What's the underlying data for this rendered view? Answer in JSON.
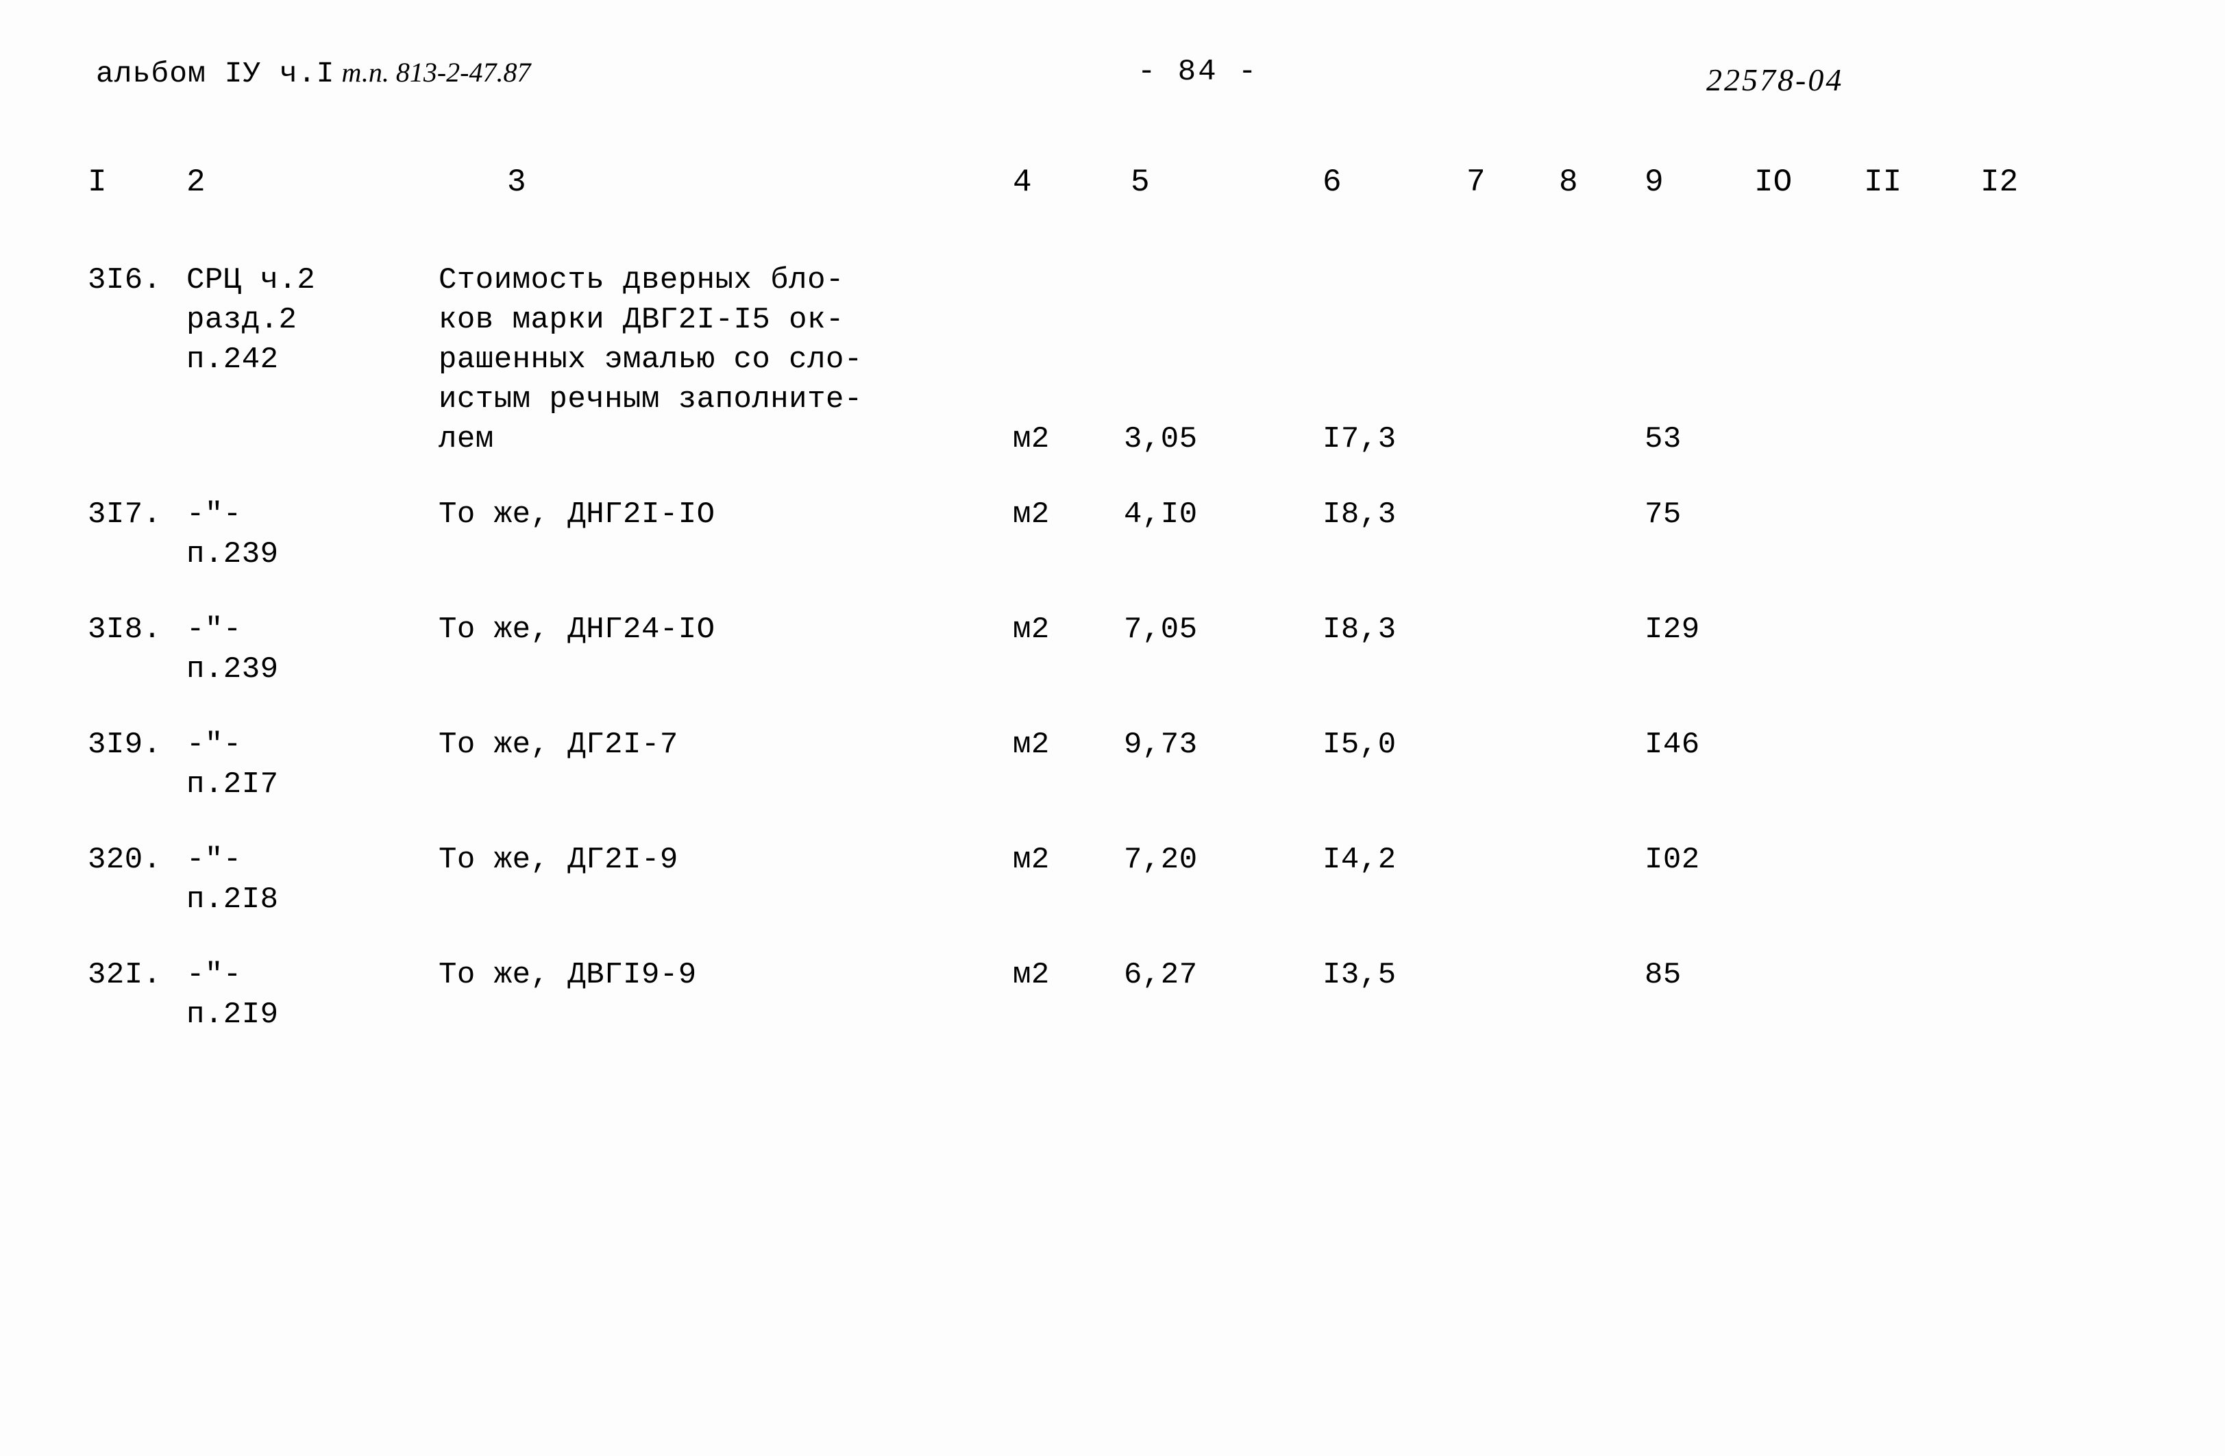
{
  "header": {
    "album_typed": "альбом IУ ч.I",
    "album_hand": "т.п. 813-2-47.87",
    "page_number": "- 84 -",
    "stamp": "22578-04"
  },
  "table": {
    "column_numbers": [
      "I",
      "2",
      "3",
      "4",
      "5",
      "6",
      "7",
      "8",
      "9",
      "IO",
      "II",
      "I2"
    ],
    "rule_dashes": "- - - - - - - - - - - - - - - - - - - - - - - - - - - - - - - - - - - - - - - - - - - - - - - - - - - - - -",
    "rows": [
      {
        "num": "3I6.",
        "ref": "СРЦ ч.2\nразд.2\nп.242",
        "desc": "Стоимость дверных бло-\nков марки ДВГ2I-I5 ок-\nрашенных эмалью со сло-\nистым речным заполните-\nлем",
        "unit": "м2",
        "col5": "3,05",
        "col6": "I7,3",
        "col7": "",
        "col8": "",
        "col9": "53",
        "col10": "",
        "col11": "",
        "col12": "",
        "value_offset_lines": 4
      },
      {
        "num": "3I7.",
        "ref": "-\"-\nп.239",
        "desc": "То же, ДНГ2I-IO",
        "unit": "м2",
        "col5": "4,I0",
        "col6": "I8,3",
        "col7": "",
        "col8": "",
        "col9": "75",
        "col10": "",
        "col11": "",
        "col12": "",
        "value_offset_lines": 0
      },
      {
        "num": "3I8.",
        "ref": "-\"-\nп.239",
        "desc": "То же, ДНГ24-IO",
        "unit": "м2",
        "col5": "7,05",
        "col6": "I8,3",
        "col7": "",
        "col8": "",
        "col9": "I29",
        "col10": "",
        "col11": "",
        "col12": "",
        "value_offset_lines": 0
      },
      {
        "num": "3I9.",
        "ref": "-\"-\nп.2I7",
        "desc": "То же, ДГ2I-7",
        "unit": "м2",
        "col5": "9,73",
        "col6": "I5,0",
        "col7": "",
        "col8": "",
        "col9": "I46",
        "col10": "",
        "col11": "",
        "col12": "",
        "value_offset_lines": 0
      },
      {
        "num": "320.",
        "ref": "-\"-\nп.2I8",
        "desc": "То же, ДГ2I-9",
        "unit": "м2",
        "col5": "7,20",
        "col6": "I4,2",
        "col7": "",
        "col8": "",
        "col9": "I02",
        "col10": "",
        "col11": "",
        "col12": "",
        "value_offset_lines": 0
      },
      {
        "num": "32I.",
        "ref": "-\"-\nп.2I9",
        "desc": "То же, ДВГI9-9",
        "unit": "м2",
        "col5": "6,27",
        "col6": "I3,5",
        "col7": "",
        "col8": "",
        "col9": "85",
        "col10": "",
        "col11": "",
        "col12": "",
        "value_offset_lines": 0
      }
    ]
  }
}
